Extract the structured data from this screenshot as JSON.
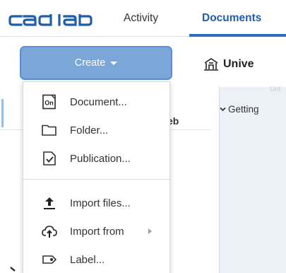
{
  "brand": {
    "logo_text": "cad lab",
    "logo_color": "#1f5ea8"
  },
  "nav": {
    "tabs": [
      {
        "label": "Activity",
        "active": false
      },
      {
        "label": "Documents",
        "active": true
      }
    ],
    "accent": "#2c6fc0"
  },
  "toolbar": {
    "create_label": "Create",
    "workspace_title": "Unive",
    "workspace_icon": "building-icon",
    "faint_text": "Unt"
  },
  "left_panel": {
    "partial_label": "eb"
  },
  "right_panel": {
    "header_label": "Getting"
  },
  "create_menu": {
    "items": [
      {
        "label": "Document...",
        "icon": "document-onshape-icon"
      },
      {
        "label": "Folder...",
        "icon": "folder-icon"
      },
      {
        "label": "Publication...",
        "icon": "publication-icon"
      },
      {
        "label": "Import files...",
        "icon": "upload-icon"
      },
      {
        "label": "Import from",
        "icon": "cloud-upload-icon",
        "has_submenu": true
      },
      {
        "label": "Label...",
        "icon": "label-tag-icon"
      }
    ]
  },
  "colors": {
    "create_button": "#7aa6d8",
    "create_border": "#5a8fd2",
    "right_pane_bg": "#ecf1f8"
  }
}
